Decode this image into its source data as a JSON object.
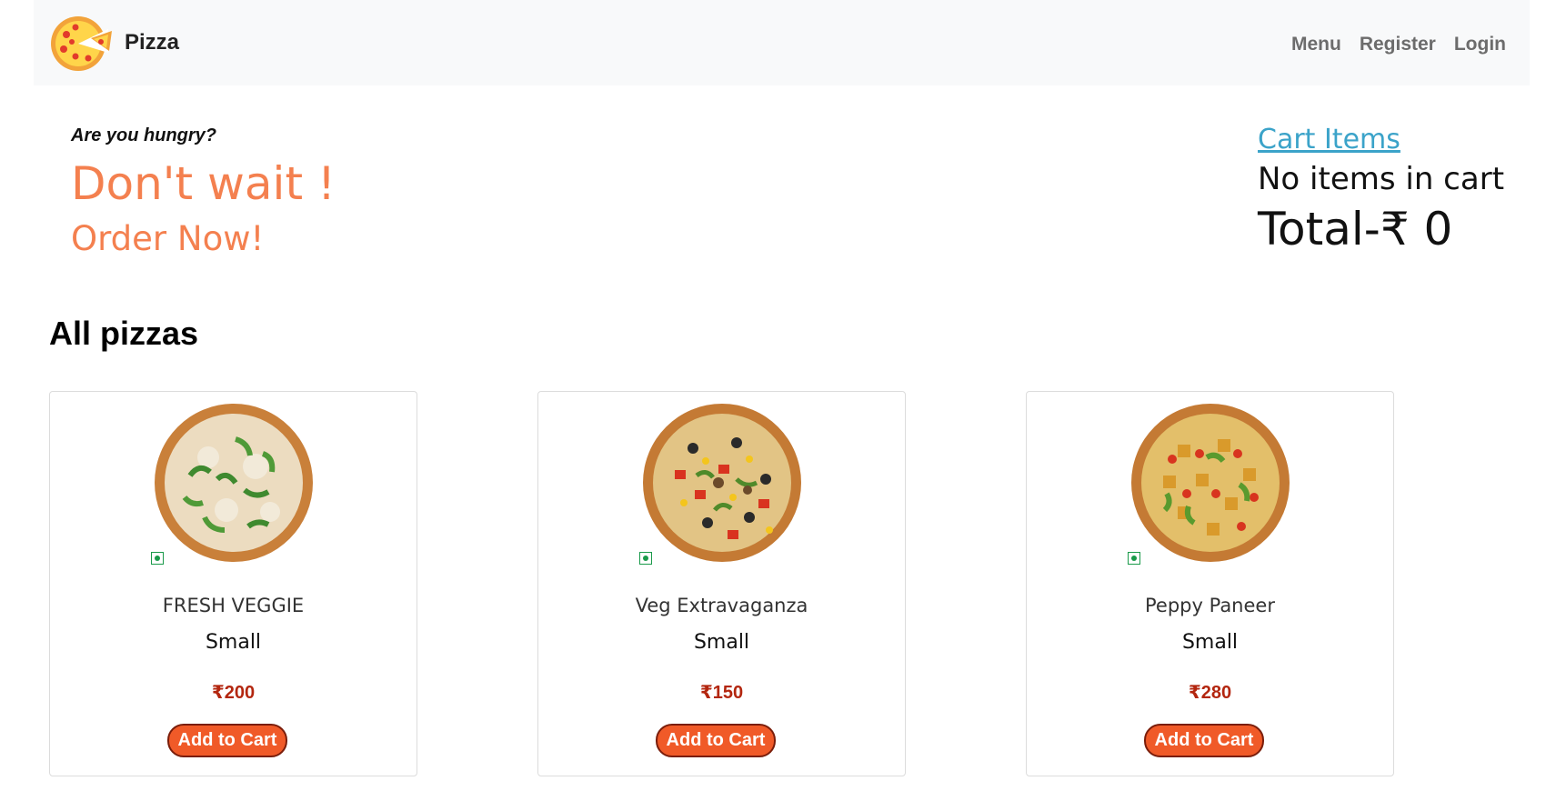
{
  "navbar": {
    "brand": "Pizza",
    "links": [
      "Menu",
      "Register",
      "Login"
    ]
  },
  "hero": {
    "tagline": "Are you hungry?",
    "headline": "Don't wait !",
    "subheadline": "Order Now!"
  },
  "cart": {
    "link_label": "Cart Items",
    "empty_text": "No items in cart",
    "total_text": "Total-₹ 0"
  },
  "section": {
    "title": "All pizzas"
  },
  "pizzas": [
    {
      "name": "FRESH VEGGIE",
      "size": "Small",
      "price": "₹200",
      "button": "Add to Cart"
    },
    {
      "name": "Veg Extravaganza",
      "size": "Small",
      "price": "₹150",
      "button": "Add to Cart"
    },
    {
      "name": "Peppy Paneer",
      "size": "Small",
      "price": "₹280",
      "button": "Add to Cart"
    }
  ],
  "colors": {
    "accent": "#f4804f",
    "button": "#f05a28",
    "price": "#b3260f",
    "link": "#3ba3c9",
    "veg": "#1a9a4a"
  }
}
